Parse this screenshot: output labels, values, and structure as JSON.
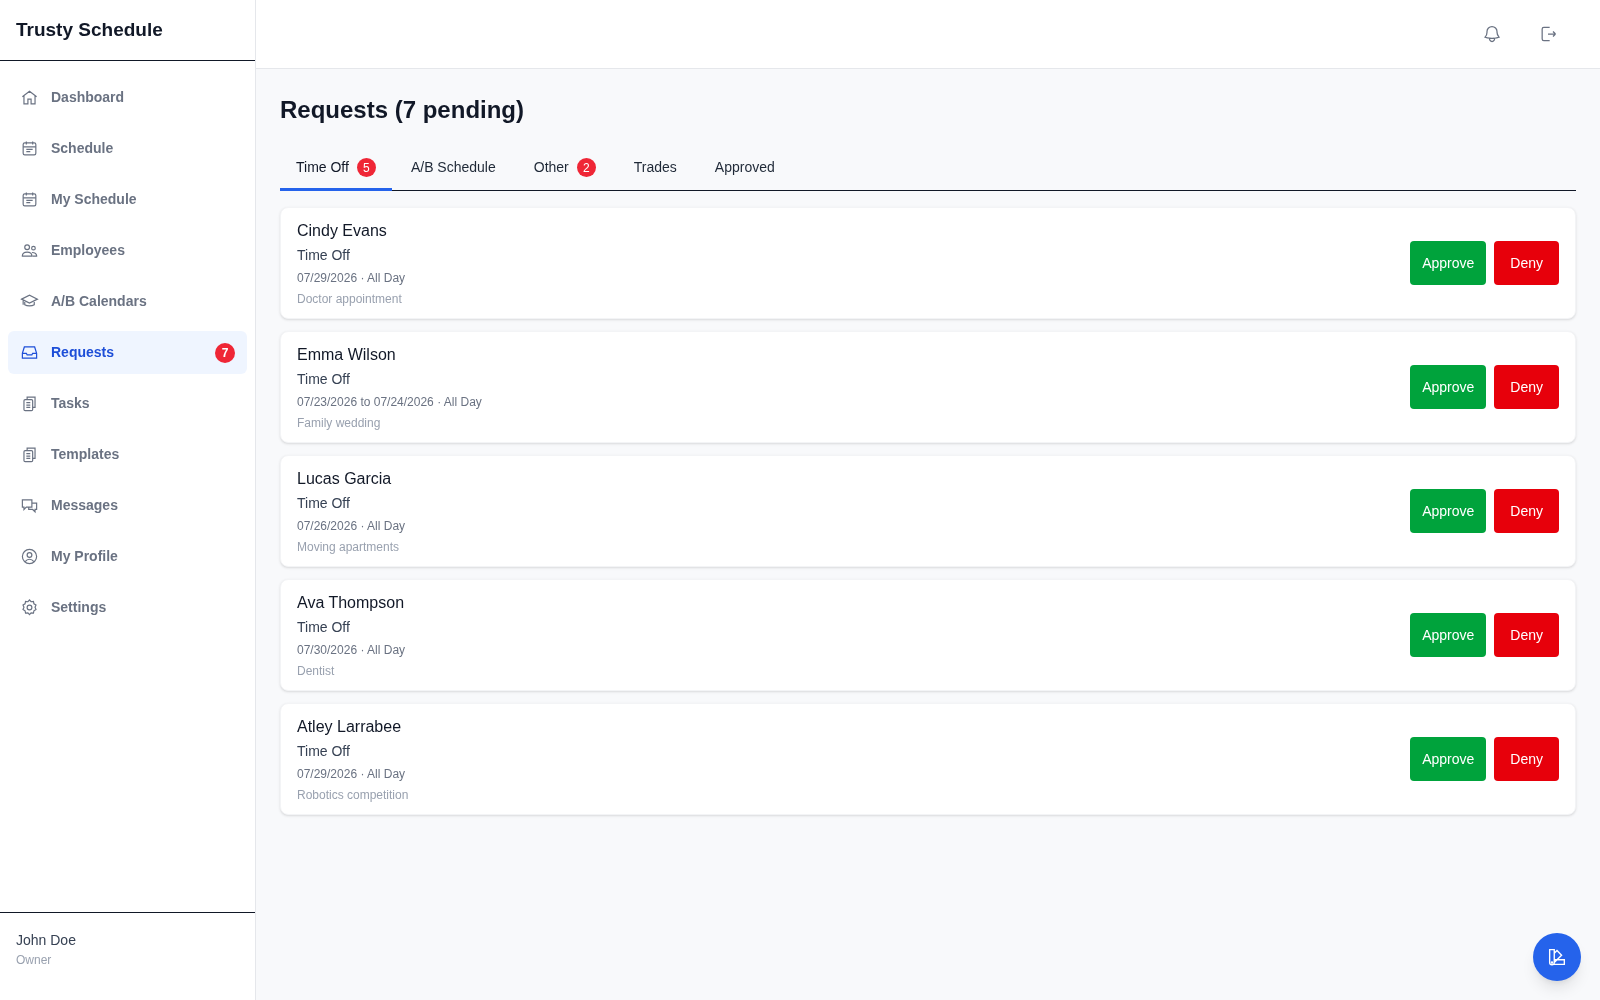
{
  "app": {
    "title": "Trusty Schedule"
  },
  "sidebar": {
    "items": [
      {
        "label": "Dashboard",
        "selected": false
      },
      {
        "label": "Schedule",
        "selected": false
      },
      {
        "label": "My Schedule",
        "selected": false
      },
      {
        "label": "Employees",
        "selected": false
      },
      {
        "label": "A/B Calendars",
        "selected": false
      },
      {
        "label": "Requests",
        "selected": true,
        "badge": "7"
      },
      {
        "label": "Tasks",
        "selected": false
      },
      {
        "label": "Templates",
        "selected": false
      },
      {
        "label": "Messages",
        "selected": false
      },
      {
        "label": "My Profile",
        "selected": false
      },
      {
        "label": "Settings",
        "selected": false
      }
    ],
    "user": {
      "name": "John Doe",
      "role": "Owner"
    }
  },
  "page": {
    "title": "Requests (7 pending)"
  },
  "tabs": [
    {
      "label": "Time Off",
      "selected": true,
      "badge": "5"
    },
    {
      "label": "A/B Schedule",
      "selected": false
    },
    {
      "label": "Other",
      "selected": false,
      "badge": "2"
    },
    {
      "label": "Trades",
      "selected": false
    },
    {
      "label": "Approved",
      "selected": false
    }
  ],
  "requests": [
    {
      "name": "Cindy Evans",
      "type": "Time Off",
      "when": "07/29/2026 · All Day",
      "reason": "Doctor appointment",
      "approve": "Approve",
      "deny": "Deny"
    },
    {
      "name": "Emma Wilson",
      "type": "Time Off",
      "when": "07/23/2026 to 07/24/2026 · All Day",
      "reason": "Family wedding",
      "approve": "Approve",
      "deny": "Deny"
    },
    {
      "name": "Lucas Garcia",
      "type": "Time Off",
      "when": "07/26/2026 · All Day",
      "reason": "Moving apartments",
      "approve": "Approve",
      "deny": "Deny"
    },
    {
      "name": "Ava Thompson",
      "type": "Time Off",
      "when": "07/30/2026 · All Day",
      "reason": "Dentist",
      "approve": "Approve",
      "deny": "Deny"
    },
    {
      "name": "Atley Larrabee",
      "type": "Time Off",
      "when": "07/29/2026 · All Day",
      "reason": "Robotics competition",
      "approve": "Approve",
      "deny": "Deny"
    }
  ]
}
